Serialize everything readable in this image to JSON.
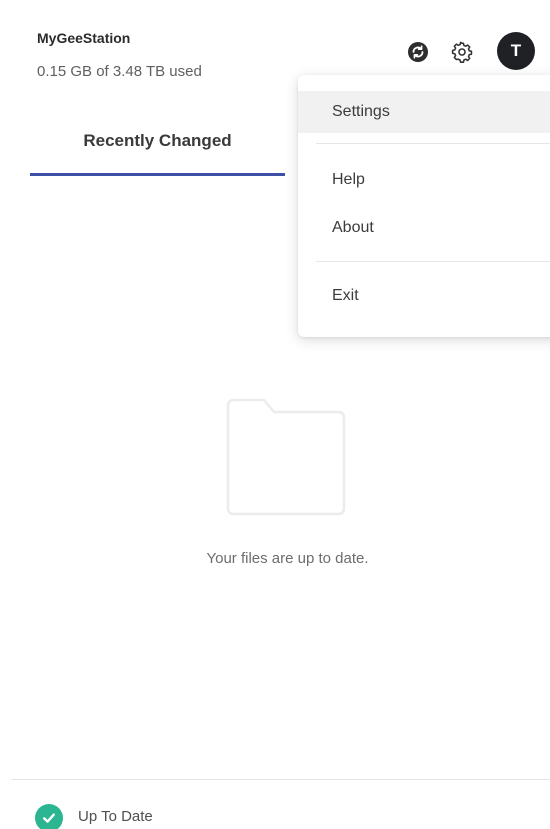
{
  "header": {
    "station_name": "MyGeeStation",
    "usage": "0.15 GB of 3.48 TB used",
    "avatar_initial": "T",
    "icons": [
      "sync-icon",
      "gear-icon"
    ]
  },
  "tabs": [
    {
      "label": "Recently Changed",
      "active": true
    }
  ],
  "empty_state": {
    "icon": "folder-icon",
    "message": "Your files are up to date."
  },
  "status": {
    "icon": "check-circle-icon",
    "label": "Up To Date",
    "color": "#2bb591"
  },
  "menu": {
    "items": [
      {
        "label": "Settings",
        "highlighted": true
      },
      {
        "label": "Help"
      },
      {
        "label": "About"
      },
      {
        "label": "Exit"
      }
    ]
  },
  "colors": {
    "tab_indicator": "#3f4fa8",
    "avatar_bg": "#1f2124"
  }
}
